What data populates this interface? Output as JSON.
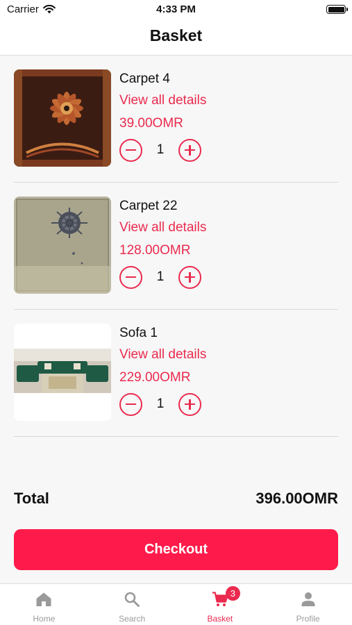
{
  "status_bar": {
    "carrier": "Carrier",
    "time": "4:33 PM"
  },
  "header": {
    "title": "Basket"
  },
  "items": [
    {
      "name": "Carpet 4",
      "details_link": "View all details",
      "price": "39.00OMR",
      "quantity": "1",
      "image": "red-mandala-carpet"
    },
    {
      "name": "Carpet 22",
      "details_link": "View all details",
      "price": "128.00OMR",
      "quantity": "1",
      "image": "beige-medallion-carpet"
    },
    {
      "name": "Sofa 1",
      "details_link": "View all details",
      "price": "229.00OMR",
      "quantity": "1",
      "image": "green-sofa-living-room"
    }
  ],
  "summary": {
    "total_label": "Total",
    "total_value": "396.00OMR"
  },
  "checkout_label": "Checkout",
  "tabs": [
    {
      "label": "Home",
      "icon": "home-icon"
    },
    {
      "label": "Search",
      "icon": "search-icon"
    },
    {
      "label": "Basket",
      "icon": "cart-icon",
      "badge": "3",
      "active": true
    },
    {
      "label": "Profile",
      "icon": "person-icon"
    }
  ],
  "colors": {
    "accent": "#ea2a4e",
    "checkout": "#fe1b4b",
    "inactive": "#9a9a9a"
  }
}
